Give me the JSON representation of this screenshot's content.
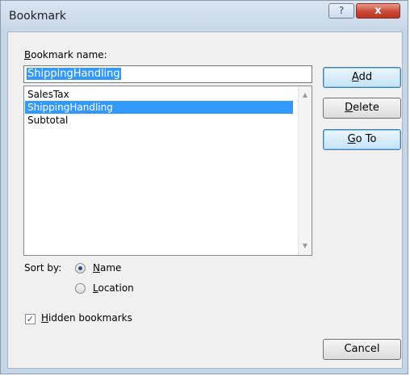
{
  "window": {
    "title": "Bookmark",
    "help_glyph": "?",
    "close_glyph": "x"
  },
  "bookmark_name": {
    "label_accel": "B",
    "label_rest": "ookmark name:",
    "value": "ShippingHandling"
  },
  "list": {
    "items": [
      "SalesTax",
      "ShippingHandling",
      "Subtotal"
    ],
    "selected_index": 1
  },
  "buttons": {
    "add_accel": "A",
    "add_rest": "dd",
    "delete_accel": "D",
    "delete_rest": "elete",
    "goto_accel": "G",
    "goto_rest": "o To",
    "cancel": "Cancel"
  },
  "sort": {
    "label": "Sort by:",
    "name_accel": "N",
    "name_rest": "ame",
    "location_accel": "L",
    "location_rest": "ocation",
    "selected": "Name"
  },
  "hidden": {
    "accel": "H",
    "rest": "idden bookmarks",
    "checked": true
  },
  "icons": {
    "scroll_up": "up-arrow-icon",
    "scroll_down": "down-arrow-icon",
    "check": "checkmark-icon"
  },
  "colors": {
    "selection": "#3399ff",
    "close_button": "#c94935",
    "title_bar": "#c7d7e8"
  }
}
